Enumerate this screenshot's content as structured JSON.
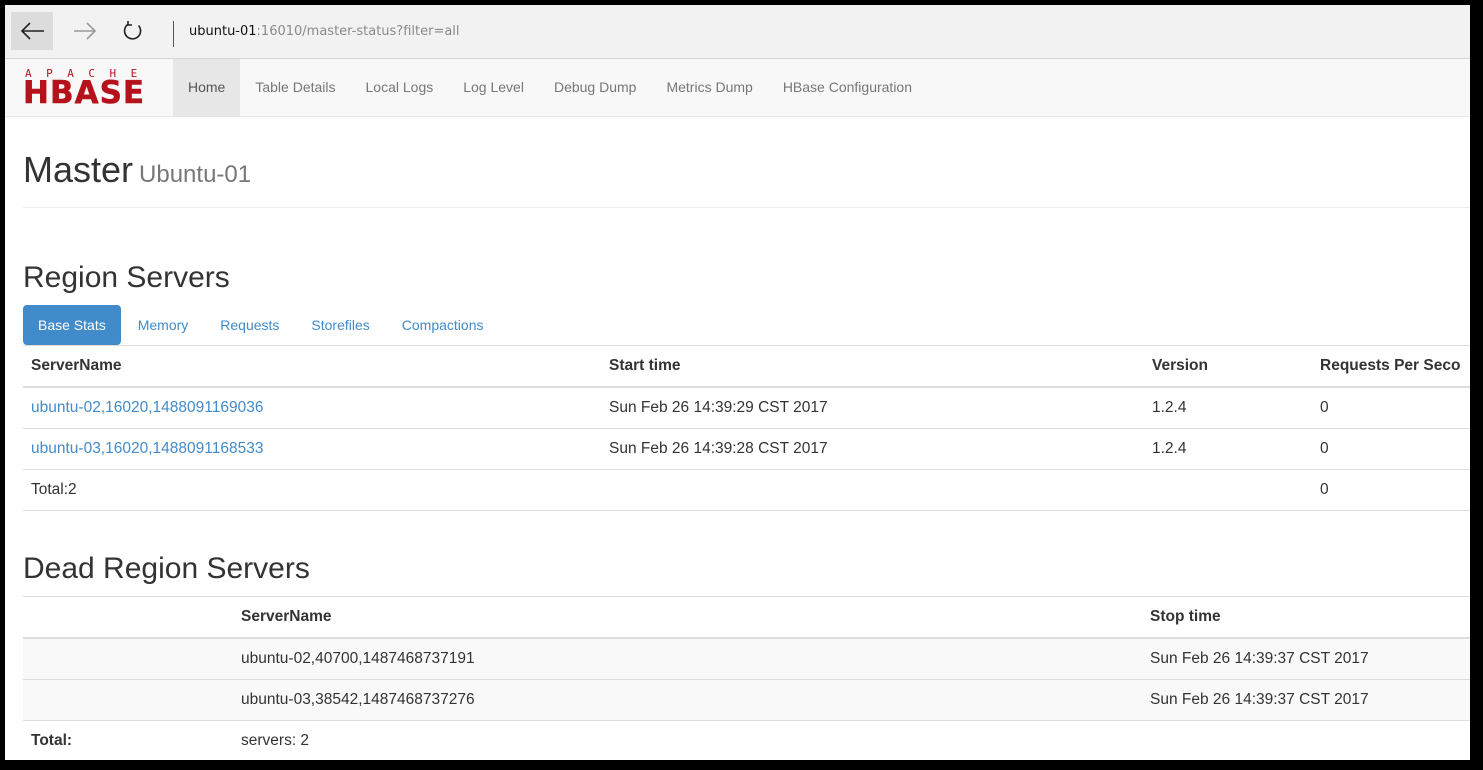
{
  "browser": {
    "url_host": "ubuntu-01",
    "url_rest": ":16010/master-status?filter=all"
  },
  "logo": {
    "top": "APACHE",
    "main": "HBASE"
  },
  "nav": {
    "items": [
      "Home",
      "Table Details",
      "Local Logs",
      "Log Level",
      "Debug Dump",
      "Metrics Dump",
      "HBase Configuration"
    ]
  },
  "header": {
    "title": "Master",
    "subtitle": "Ubuntu-01"
  },
  "region_servers": {
    "title": "Region Servers",
    "tabs": [
      "Base Stats",
      "Memory",
      "Requests",
      "Storefiles",
      "Compactions"
    ],
    "columns": [
      "ServerName",
      "Start time",
      "Version",
      "Requests Per Seco"
    ],
    "rows": [
      {
        "name": "ubuntu-02,16020,1488091169036",
        "start": "Sun Feb 26 14:39:29 CST 2017",
        "version": "1.2.4",
        "rps": "0"
      },
      {
        "name": "ubuntu-03,16020,1488091168533",
        "start": "Sun Feb 26 14:39:28 CST 2017",
        "version": "1.2.4",
        "rps": "0"
      }
    ],
    "total_label": "Total:2",
    "total_rps": "0"
  },
  "dead_region_servers": {
    "title": "Dead Region Servers",
    "columns": [
      "ServerName",
      "Stop time"
    ],
    "rows": [
      {
        "name": "ubuntu-02,40700,1487468737191",
        "stop": "Sun Feb 26 14:39:37 CST 2017"
      },
      {
        "name": "ubuntu-03,38542,1487468737276",
        "stop": "Sun Feb 26 14:39:37 CST 2017"
      }
    ],
    "total_label": "Total:",
    "total_value": "servers: 2"
  },
  "colors": {
    "brand": "#b5121b",
    "link": "#428bca",
    "active_tab": "#428bca"
  }
}
